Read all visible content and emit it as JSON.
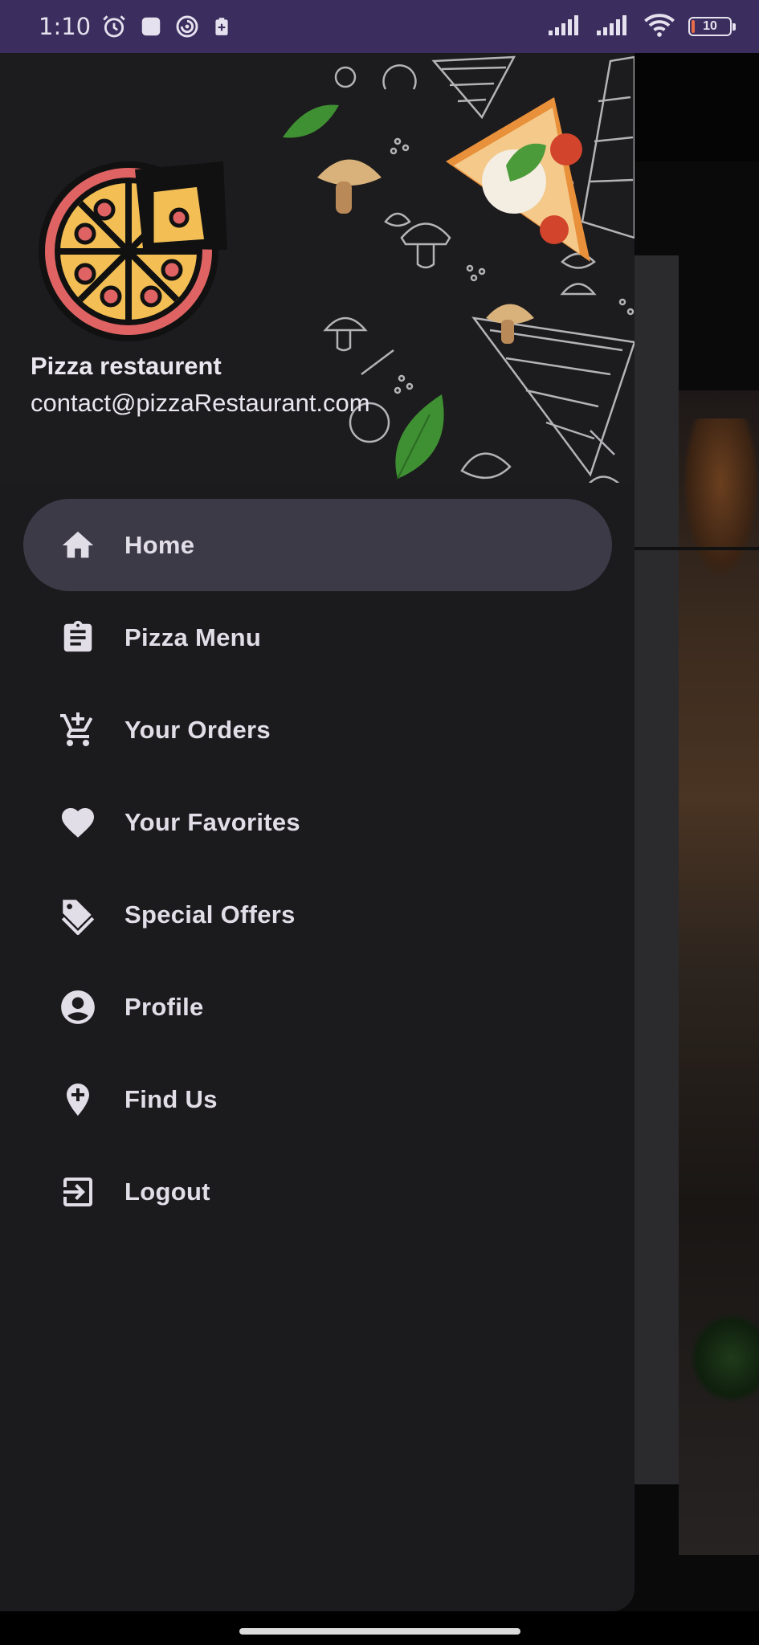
{
  "status_bar": {
    "time": "1:10",
    "battery_level": "10",
    "icons": [
      "alarm-icon",
      "square-app-icon",
      "swirl-app-icon",
      "battery-saver-icon",
      "signal-icon",
      "signal-icon",
      "wifi-icon",
      "battery-icon"
    ]
  },
  "drawer": {
    "header": {
      "name": "Pizza restaurent",
      "email": "contact@pizzaRestaurant.com"
    },
    "items": [
      {
        "label": "Home",
        "icon": "home-icon",
        "active": true
      },
      {
        "label": "Pizza Menu",
        "icon": "clipboard-icon",
        "active": false
      },
      {
        "label": "Your Orders",
        "icon": "add-cart-icon",
        "active": false
      },
      {
        "label": "Your Favorites",
        "icon": "heart-icon",
        "active": false
      },
      {
        "label": "Special Offers",
        "icon": "tags-icon",
        "active": false
      },
      {
        "label": "Profile",
        "icon": "account-circle-icon",
        "active": false
      },
      {
        "label": "Find Us",
        "icon": "add-location-icon",
        "active": false
      },
      {
        "label": "Logout",
        "icon": "logout-icon",
        "active": false
      }
    ]
  },
  "colors": {
    "status_bar": "#3b2e5e",
    "drawer_bg": "#1b1a1d",
    "active_item_bg": "#3d3a48",
    "text": "#e2dee8"
  }
}
